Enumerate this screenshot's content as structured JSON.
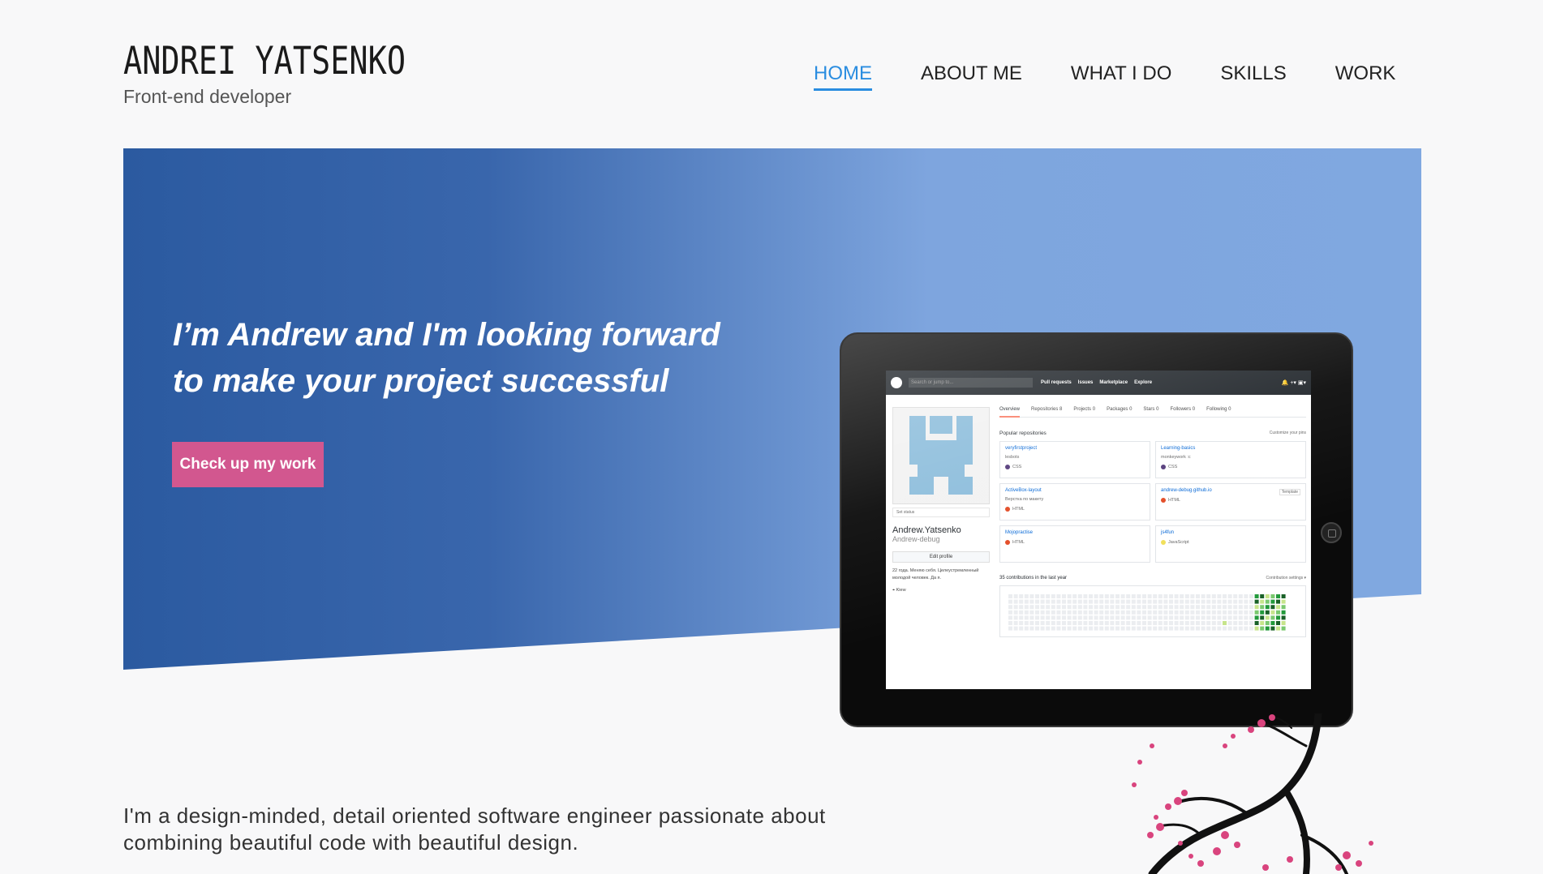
{
  "header": {
    "name": "ANDREI YATSENKO",
    "subtitle": "Front-end developer"
  },
  "nav": [
    {
      "label": "HOME",
      "active": true
    },
    {
      "label": "ABOUT ME",
      "active": false
    },
    {
      "label": "WHAT I DO",
      "active": false
    },
    {
      "label": "SKILLS",
      "active": false
    },
    {
      "label": "WORK",
      "active": false
    }
  ],
  "hero": {
    "headline_line1": "I’m Andrew and I'm looking forward",
    "headline_line2": "to make your project successful",
    "cta_label": "Check up my work",
    "gradient_from": "#2b5aa0",
    "gradient_to": "#80a8e0",
    "cta_color": "#d2578f"
  },
  "intro": {
    "text": "I'm a design-minded, detail oriented software engineer passionate about combining beautiful code with beautiful design."
  },
  "tablet_screen": {
    "search_placeholder": "Search or jump to...",
    "top_links": [
      "Pull requests",
      "Issues",
      "Marketplace",
      "Explore"
    ],
    "tabs": [
      "Overview",
      "Repositories 8",
      "Projects 0",
      "Packages 0",
      "Stars 0",
      "Followers 0",
      "Following 0"
    ],
    "set_status": "Set status",
    "profile_name": "Andrew.Yatsenko",
    "profile_login": "Andrew-debug",
    "edit_profile": "Edit profile",
    "bio": "22 года. Меняю себя. Целеустремленный молодой человек. Да я.",
    "location": "Kiew",
    "popular_title": "Popular repositories",
    "customize": "Customize your pins",
    "repos": [
      {
        "name": "veryfirstproject",
        "desc": "lesbots",
        "lang": "CSS",
        "color": "#563d7c",
        "badge": ""
      },
      {
        "name": "Learning-basics",
        "desc": "monkeywork :c",
        "lang": "CSS",
        "color": "#563d7c",
        "badge": ""
      },
      {
        "name": "ActiveBox-layout",
        "desc": "Верстка по макету",
        "lang": "HTML",
        "color": "#e34c26",
        "badge": ""
      },
      {
        "name": "andrew-debug.github.io",
        "desc": "",
        "lang": "HTML",
        "color": "#e34c26",
        "badge": "Template"
      },
      {
        "name": "Mojopractise",
        "desc": "",
        "lang": "HTML",
        "color": "#e34c26",
        "badge": ""
      },
      {
        "name": "js4fun",
        "desc": "",
        "lang": "JavaScript",
        "color": "#f1e05a",
        "badge": ""
      }
    ],
    "contrib_title": "35 contributions in the last year",
    "contrib_settings": "Contribution settings ▾"
  }
}
